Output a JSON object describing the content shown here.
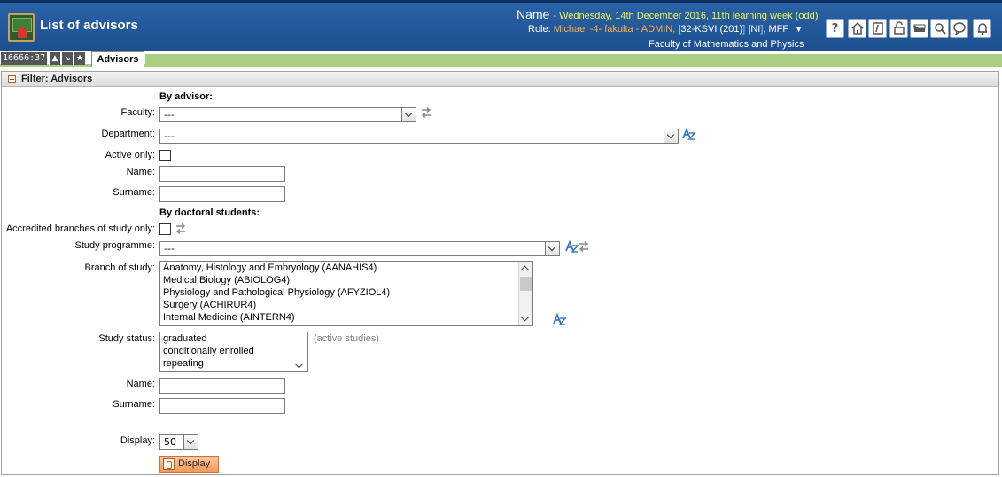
{
  "header": {
    "title": "List of advisors",
    "name_label": "Name",
    "date": "- Wednesday, 14th December 2016, 11th learning week (odd)",
    "role_label": "Role:",
    "role_value": "Michael -4- fakulta - ADMIN,",
    "role_code": "32-KSVI (201)",
    "role_code2": "NI",
    "role_code3": ", MFF",
    "faculty": "Faculty of Mathematics and Physics",
    "tools": [
      "help-icon",
      "home-icon",
      "notes-icon",
      "lock-icon",
      "flag-icon",
      "search-abc-icon",
      "chat-icon",
      "bell-icon"
    ]
  },
  "tabbar": {
    "session_id": "16666:37",
    "active_tab": "Advisors"
  },
  "filter": {
    "title": "Filter: Advisors",
    "by_advisor": "By advisor:",
    "faculty_label": "Faculty:",
    "faculty_value": "---",
    "department_label": "Department:",
    "department_value": "---",
    "active_only_label": "Active only:",
    "name_label": "Name:",
    "surname_label": "Surname:",
    "by_students": "By doctoral students:",
    "accredited_label": "Accredited branches of study only:",
    "programme_label": "Study programme:",
    "programme_value": "---",
    "branch_label": "Branch of study:",
    "branches": [
      "Anatomy, Histology and Embryology (AANAHIS4)",
      "Medical Biology (ABIOLOG4)",
      "Physiology and Pathological Physiology (AFYZIOL4)",
      "Surgery (ACHIRUR4)",
      "Internal Medicine (AINTERN4)"
    ],
    "status_label": "Study status:",
    "statuses": [
      "graduated",
      "conditionally enrolled",
      "repeating"
    ],
    "status_hint": "(active studies)",
    "name2_label": "Name:",
    "surname2_label": "Surname:",
    "display_label": "Display:",
    "display_value": "50",
    "display_button": "Display"
  }
}
